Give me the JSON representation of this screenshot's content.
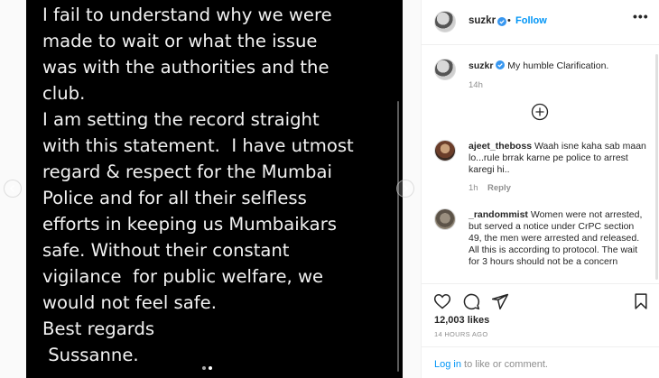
{
  "post_image": {
    "lines": [
      "I fail to understand why we were",
      "made to wait or what the issue",
      "was with the authorities and the",
      "club.",
      "I am setting the record straight",
      "with this statement.  I have utmost",
      "regard & respect for the Mumbai",
      "Police and for all their selfless",
      "efforts in keeping us Mumbaikars",
      "safe. Without their constant",
      "vigilance  for public welfare, we",
      "would not feel safe.",
      "Best regards",
      " Sussanne."
    ]
  },
  "header": {
    "username": "suzkr",
    "separator": "•",
    "follow_label": "Follow",
    "more_label": "•••"
  },
  "caption": {
    "username": "suzkr",
    "text": "My humble Clarification.",
    "time": "14h"
  },
  "comments": [
    {
      "username": "ajeet_theboss",
      "text": "Waah isne kaha sab maan lo...rule brrak karne pe police to arrest karegi hi..",
      "time": "1h",
      "reply_label": "Reply"
    },
    {
      "username": "_randommist",
      "text": "Women were not arrested, but served a notice under CrPC section 49, the men were arrested and released. All this is according to protocol. The wait for 3 hours should not be a concern"
    }
  ],
  "stats": {
    "likes_count": "12,003",
    "likes_word": "likes",
    "posted_time": "14 HOURS AGO"
  },
  "login": {
    "link_label": "Log in",
    "suffix": "to like or comment."
  },
  "colors": {
    "accent": "#0095f6",
    "image_bg": "#000000",
    "text": "#262626",
    "muted": "#8e8e8e"
  }
}
